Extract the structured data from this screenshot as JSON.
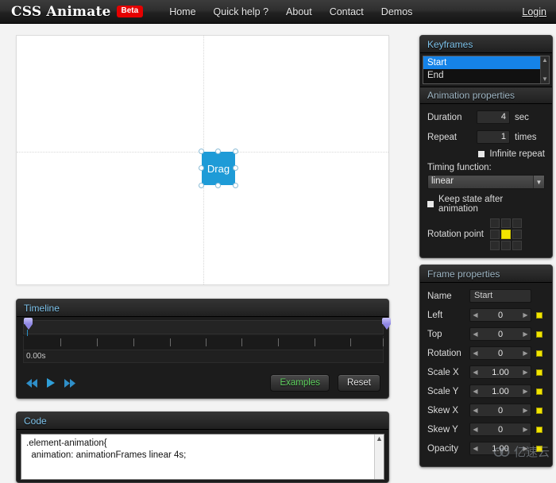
{
  "navbar": {
    "brand": "CSS Animate",
    "badge": "Beta",
    "links": [
      {
        "label": "Home"
      },
      {
        "label": "Quick help ?"
      },
      {
        "label": "About"
      },
      {
        "label": "Contact"
      },
      {
        "label": "Demos"
      }
    ],
    "login": "Login"
  },
  "stage": {
    "element_label": "Drag"
  },
  "timeline": {
    "title": "Timeline",
    "current_time": "0.00s",
    "rewind_icon": "rewind-icon",
    "play_icon": "play-icon",
    "forward_icon": "fast-forward-icon",
    "examples_label": "Examples",
    "reset_label": "Reset"
  },
  "code": {
    "title": "Code",
    "content": ".element-animation{\n  animation: animationFrames linear 4s;"
  },
  "keyframes": {
    "title": "Keyframes",
    "items": [
      {
        "label": "Start",
        "selected": true
      },
      {
        "label": "End",
        "selected": false
      }
    ]
  },
  "animation_properties": {
    "title": "Animation properties",
    "duration_label": "Duration",
    "duration_value": "4",
    "duration_unit": "sec",
    "repeat_label": "Repeat",
    "repeat_value": "1",
    "repeat_unit": "times",
    "infinite_repeat_label": "Infinite repeat",
    "timing_function_label": "Timing function:",
    "timing_function_value": "linear",
    "timing_function_options": [
      "linear"
    ],
    "keep_state_label": "Keep state after animation",
    "rotation_point_label": "Rotation point",
    "rotation_point_active_index": 4
  },
  "frame_properties": {
    "title": "Frame properties",
    "name_label": "Name",
    "name_value": "Start",
    "rows": [
      {
        "label": "Left",
        "value": "0"
      },
      {
        "label": "Top",
        "value": "0"
      },
      {
        "label": "Rotation",
        "value": "0"
      },
      {
        "label": "Scale X",
        "value": "1.00"
      },
      {
        "label": "Scale Y",
        "value": "1.00"
      },
      {
        "label": "Skew X",
        "value": "0"
      },
      {
        "label": "Skew Y",
        "value": "0"
      },
      {
        "label": "Opacity",
        "value": "1.00"
      }
    ]
  },
  "watermark": {
    "text": "亿速云"
  },
  "colors": {
    "accent_blue": "#1e9bd7",
    "badge_red": "#e60000",
    "panel_title": "#7fc4ec",
    "selection_blue": "#1583e8",
    "yellow": "#f2e500",
    "green": "#5fd35f"
  }
}
